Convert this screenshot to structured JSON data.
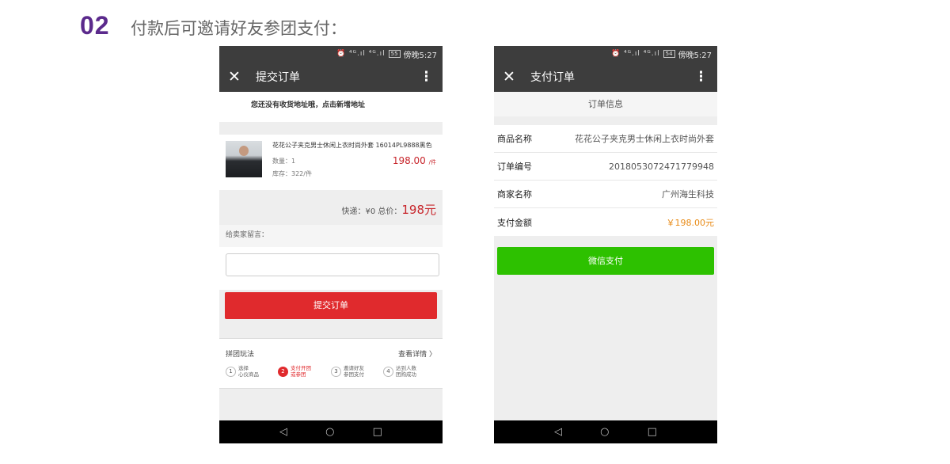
{
  "slide": {
    "step_number": "02",
    "heading": "付款后可邀请好友参团支付："
  },
  "status_bar": {
    "icons_text": "⏰ ⁴ᴳ.ıl ⁴ᴳ.ıl",
    "battery": "55",
    "battery_right": "54",
    "time": "傍晚5:27"
  },
  "order_screen": {
    "title": "提交订单",
    "address_notice": "您还没有收货地址哦，点击新增地址",
    "product": {
      "name": "花花公子夹克男士休闲上衣时尚外套 16014PL9888黑色",
      "quantity": "数量：1",
      "stock": "库存：322/件",
      "price": "198.00",
      "unit": "/件"
    },
    "total_prefix": "快递：¥0 总价：",
    "total_amount": "198元",
    "message_label": "给卖家留言：",
    "submit_label": "提交订单",
    "group_buy": {
      "title": "拼团玩法",
      "detail": "查看详情 〉",
      "steps": [
        {
          "num": "1",
          "line1": "选择",
          "line2": "心仪商品"
        },
        {
          "num": "2",
          "line1": "支付开团",
          "line2": "或参团"
        },
        {
          "num": "3",
          "line1": "邀请好友",
          "line2": "参团支付"
        },
        {
          "num": "4",
          "line1": "达到人数",
          "line2": "团购成功"
        }
      ]
    }
  },
  "pay_screen": {
    "title": "支付订单",
    "info_header": "订单信息",
    "rows": [
      {
        "label": "商品名称",
        "value": "花花公子夹克男士休闲上衣时尚外套"
      },
      {
        "label": "订单编号",
        "value": "2018053072471779948"
      },
      {
        "label": "商家名称",
        "value": "广州海生科技"
      },
      {
        "label": "支付金额",
        "value": "￥198.00元"
      }
    ],
    "pay_button": "微信支付"
  },
  "nav_bar": {
    "back": "◁",
    "home": "○",
    "recent": "□"
  },
  "colors": {
    "accent_red": "#e02a2d",
    "wechat_green": "#2dc100",
    "amount_orange": "#e88a15",
    "step_purple": "#5b2a8c"
  }
}
